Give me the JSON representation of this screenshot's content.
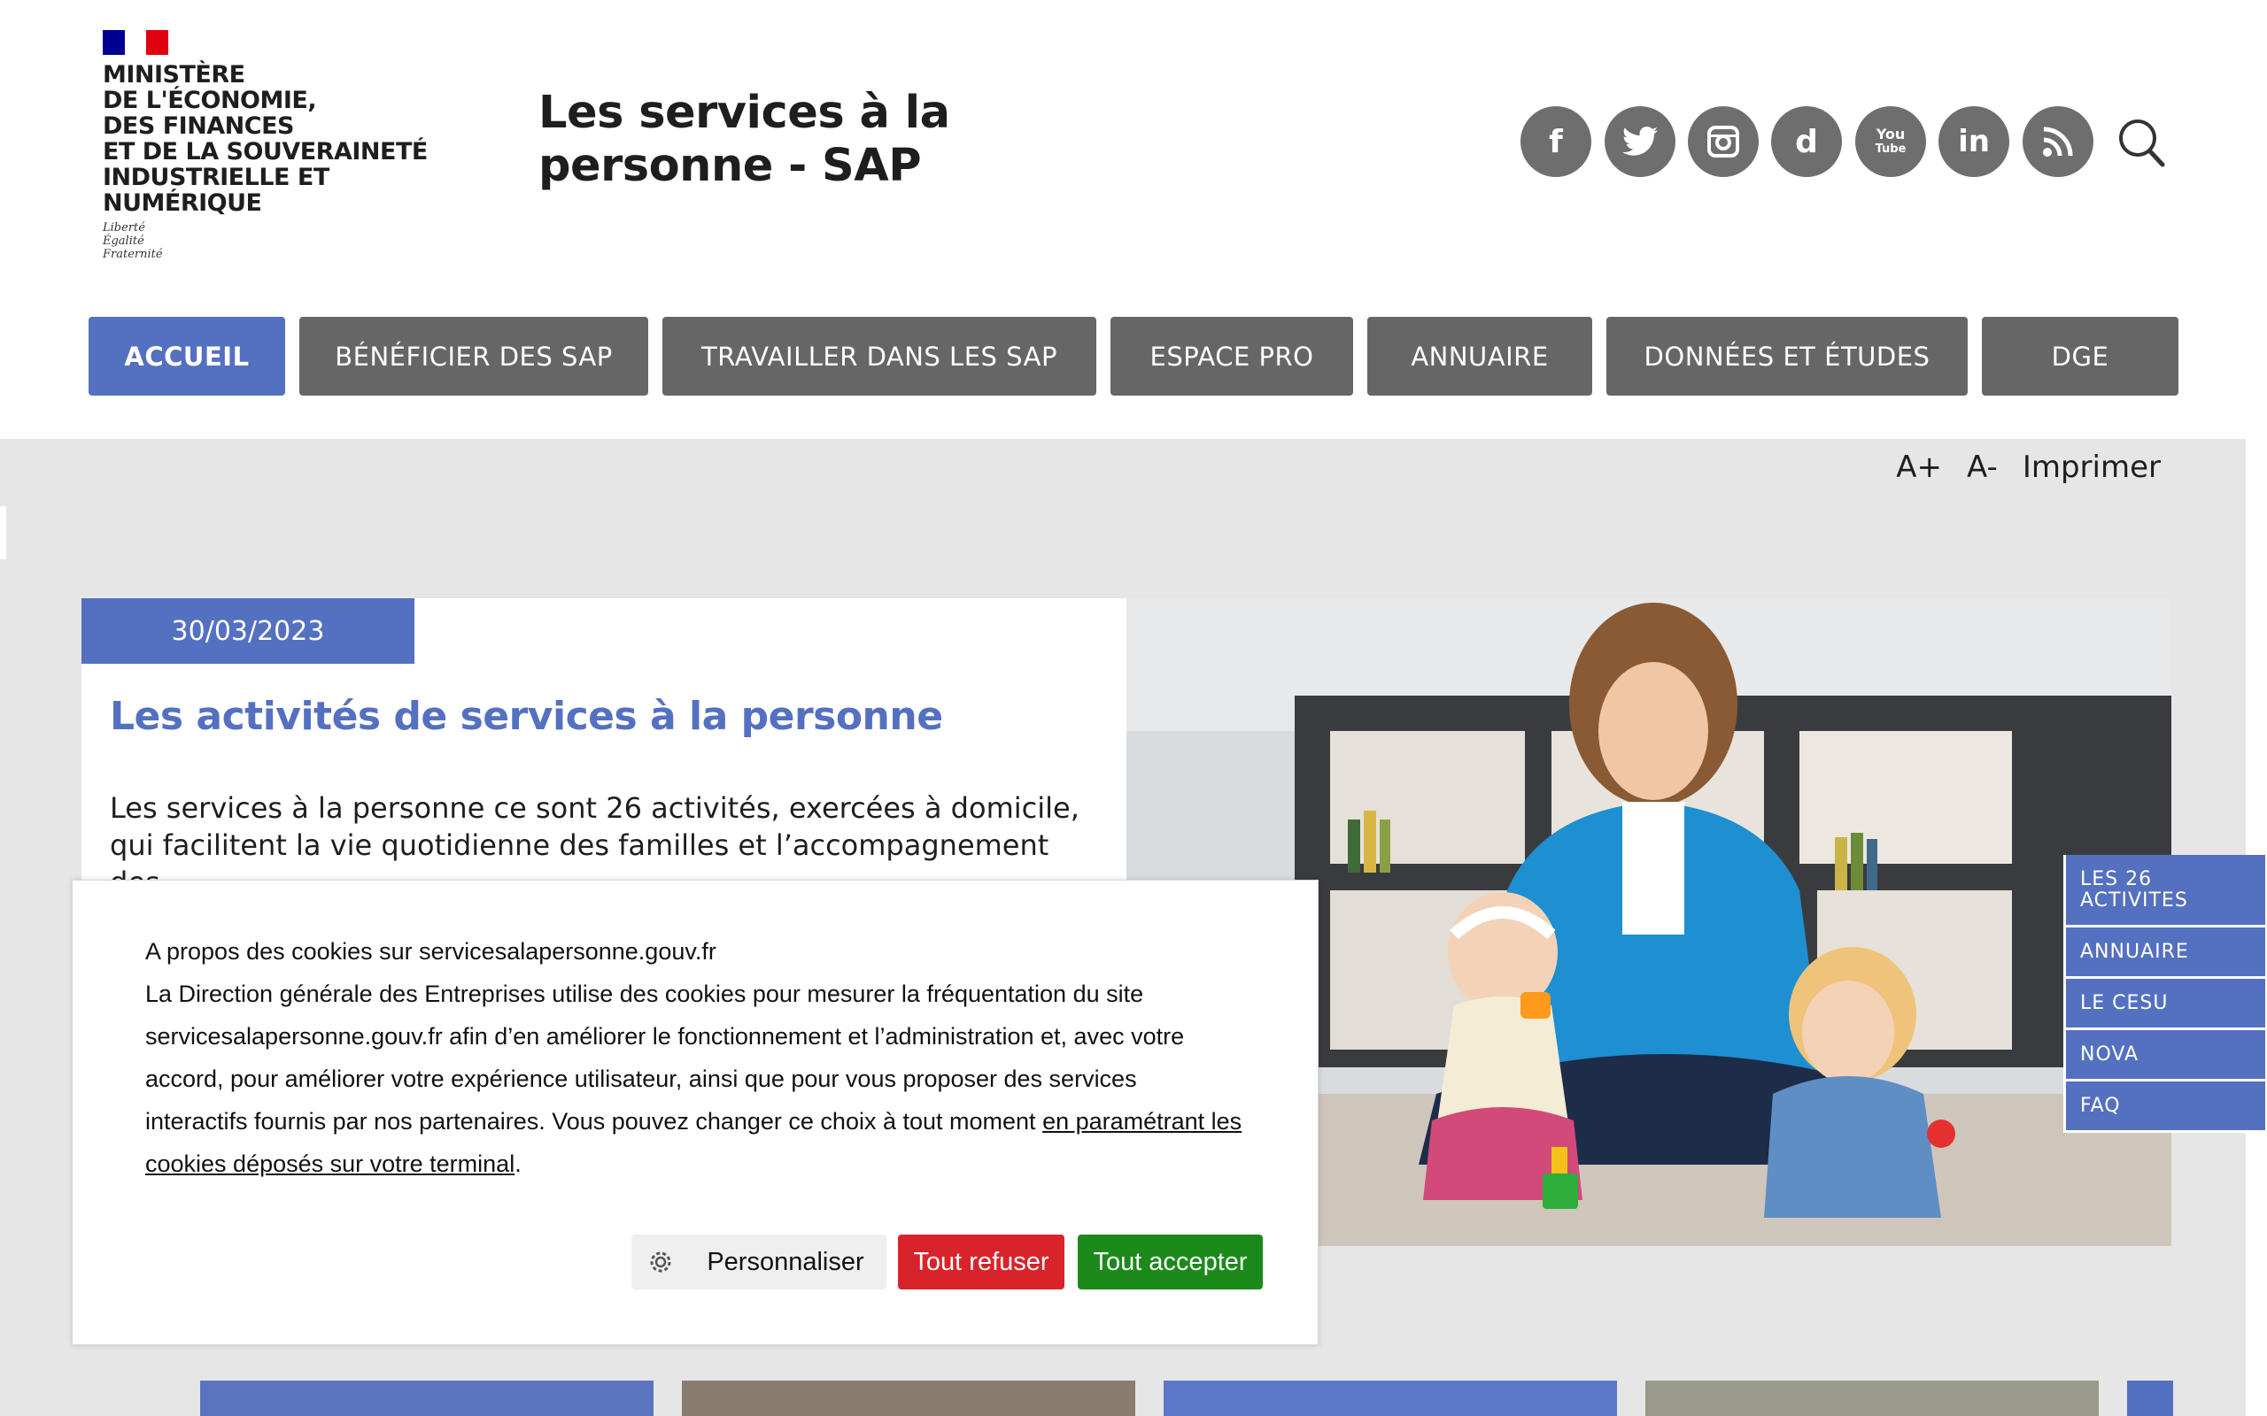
{
  "header": {
    "ministry_name": "MINISTÈRE\nDE L'ÉCONOMIE,\nDES FINANCES\nET DE LA SOUVERAINETÉ\nINDUSTRIELLE ET NUMÉRIQUE",
    "motto": "Liberté\nÉgalité\nFraternité",
    "site_title": "Les services à la\npersonne - SAP",
    "social_icons": [
      "facebook-icon",
      "twitter-icon",
      "instagram-icon",
      "dailymotion-icon",
      "youtube-icon",
      "linkedin-icon",
      "rss-icon"
    ],
    "flag_colors": [
      "#000091",
      "#ffffff",
      "#e1000f"
    ]
  },
  "nav": {
    "items": [
      "ACCUEIL",
      "BÉNÉFICIER DES SAP",
      "TRAVAILLER DANS LES SAP",
      "ESPACE PRO",
      "ANNUAIRE",
      "DONNÉES ET ÉTUDES",
      "DGE"
    ],
    "active": "ACCUEIL"
  },
  "toolbar": {
    "font_up": "A+",
    "font_down": "A-",
    "print": "Imprimer"
  },
  "article": {
    "date": "30/03/2023",
    "title": "Les activités de services à la personne",
    "text": "Les services à la personne ce sont 26 activités, exercées à domicile, qui facilitent la vie quotidienne des familles et l’accompagnement des"
  },
  "side_links": [
    "LES 26 ACTIVITES",
    "ANNUAIRE",
    "LE CESU",
    "NOVA",
    "FAQ"
  ],
  "cookie": {
    "title": "A propos des cookies sur servicesalapersonne.gouv.fr",
    "body": "La Direction générale des Entreprises utilise des cookies pour mesurer la fréquentation du site servicesalapersonne.gouv.fr afin d’en améliorer le fonctionnement et l’administration et, avec votre accord, pour améliorer votre expérience utilisateur, ainsi que pour vous proposer des services interactifs fournis par nos partenaires. Vous pouvez changer ce choix à tout moment ",
    "link": "en paramétrant les cookies déposés sur votre terminal",
    "after_link": ".",
    "personalize": "Personnaliser",
    "refuse": "Tout refuser",
    "accept": "Tout accepter"
  },
  "colors": {
    "accent": "#5470c1",
    "nav_bg": "#666666",
    "refuse": "#d9232a",
    "accept": "#1b8a1b"
  }
}
